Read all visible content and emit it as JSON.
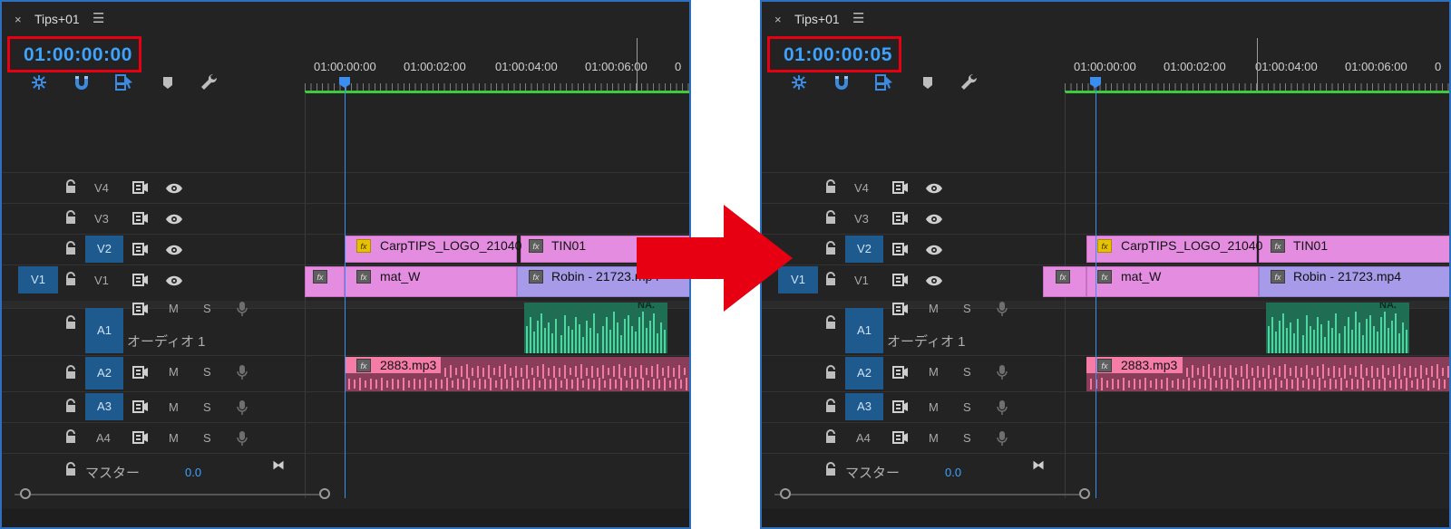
{
  "colors": {
    "arrow": "#e60012",
    "timecode": "#3ea3ff",
    "highlight_box": "#e60012",
    "ruler_bar": "#3ec93e",
    "clip_pink": "#e48de0",
    "clip_purple": "#a79ae8",
    "audio_green": "#4fd6a0",
    "audio_pink": "#ef7ba2",
    "track_selected": "#1f5a8e"
  },
  "arrow_icon": "right-arrow-icon",
  "panels": [
    {
      "title": "Tips+01",
      "timecode": "01:00:00:00",
      "ruler_labels": [
        "01:00:00:00",
        "01:00:02:00",
        "01:00:04:00",
        "01:00:06:00",
        "0"
      ],
      "video_tracks": [
        {
          "name": "V4"
        },
        {
          "name": "V3"
        },
        {
          "name": "V2"
        },
        {
          "name": "V1",
          "source": "V1"
        }
      ],
      "audio_tracks": [
        {
          "name": "A1",
          "label": "オーディオ 1",
          "m": "M",
          "s": "S"
        },
        {
          "name": "A2",
          "m": "M",
          "s": "S"
        },
        {
          "name": "A3",
          "m": "M",
          "s": "S"
        },
        {
          "name": "A4",
          "m": "M",
          "s": "S"
        }
      ],
      "master": {
        "label": "マスター",
        "value": "0.0"
      },
      "clips": {
        "v2_a": "CarpTIPS_LOGO_21040",
        "v2_b": "TIN01",
        "v1_a": "mat_W",
        "v1_b": "Robin - 21723.mp4",
        "a2": "2883.mp3",
        "fx": "fx",
        "green_marker": "NA."
      }
    },
    {
      "title": "Tips+01",
      "timecode": "01:00:00:05",
      "ruler_labels": [
        "01:00:00:00",
        "01:00:02:00",
        "01:00:04:00",
        "01:00:06:00",
        "0"
      ],
      "video_tracks": [
        {
          "name": "V4"
        },
        {
          "name": "V3"
        },
        {
          "name": "V2"
        },
        {
          "name": "V1",
          "source": "V1"
        }
      ],
      "audio_tracks": [
        {
          "name": "A1",
          "label": "オーディオ 1",
          "m": "M",
          "s": "S"
        },
        {
          "name": "A2",
          "m": "M",
          "s": "S"
        },
        {
          "name": "A3",
          "m": "M",
          "s": "S"
        },
        {
          "name": "A4",
          "m": "M",
          "s": "S"
        }
      ],
      "master": {
        "label": "マスター",
        "value": "0.0"
      },
      "clips": {
        "v2_a": "CarpTIPS_LOGO_21040",
        "v2_b": "TIN01",
        "v1_a": "mat_W",
        "v1_b": "Robin - 21723.mp4",
        "a2": "2883.mp3",
        "fx": "fx",
        "green_marker": "NA."
      }
    }
  ]
}
